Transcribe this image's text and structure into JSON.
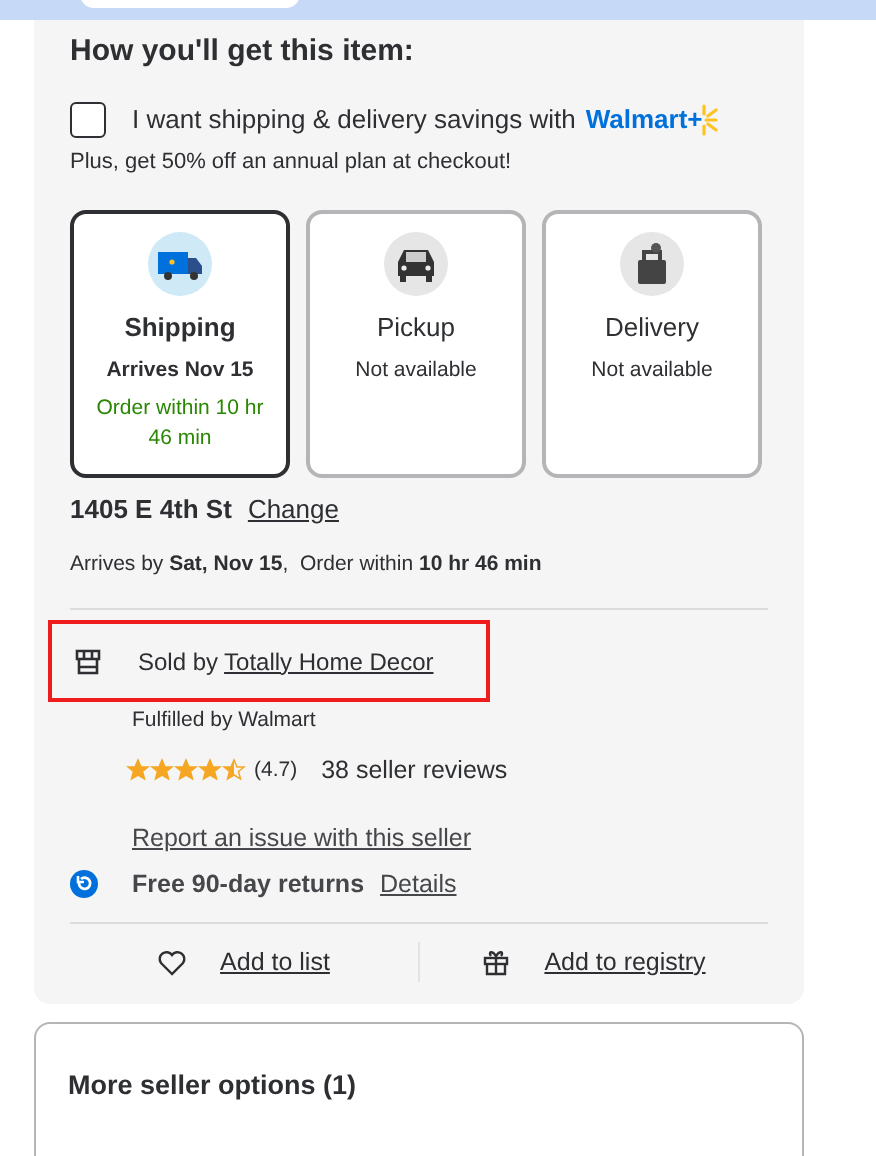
{
  "heading": "How you'll get this item:",
  "membership": {
    "checked": false,
    "label": "I want shipping & delivery savings with",
    "brand": "Walmart+",
    "note": "Plus, get 50% off an annual plan at checkout!"
  },
  "options": [
    {
      "kind": "shipping",
      "title": "Shipping",
      "subtitle": "Arrives Nov 15",
      "detail": "Order within 10 hr 46 min",
      "selected": true
    },
    {
      "kind": "pickup",
      "title": "Pickup",
      "subtitle": "Not available",
      "selected": false
    },
    {
      "kind": "delivery",
      "title": "Delivery",
      "subtitle": "Not available",
      "selected": false
    }
  ],
  "address": {
    "street": "1405 E 4th St",
    "change": "Change"
  },
  "arrival": "Arrives by **Sat, Nov 15**,  Order within **10 hr 46 min**",
  "seller": {
    "prefix": "Sold by",
    "name": "Totally Home Decor",
    "highlighted": true,
    "fulfilled": "Fulfilled by Walmart",
    "stars": 4.5,
    "rating": "(4.7)",
    "reviews": "38 seller reviews",
    "report": "Report an issue with this seller"
  },
  "returns": {
    "label": "Free 90-day returns",
    "link": "Details"
  },
  "actions": [
    {
      "kind": "list",
      "label": "Add to list"
    },
    {
      "kind": "registry",
      "label": "Add to registry"
    }
  ],
  "more_sellers": {
    "title": "More seller options (1)"
  }
}
